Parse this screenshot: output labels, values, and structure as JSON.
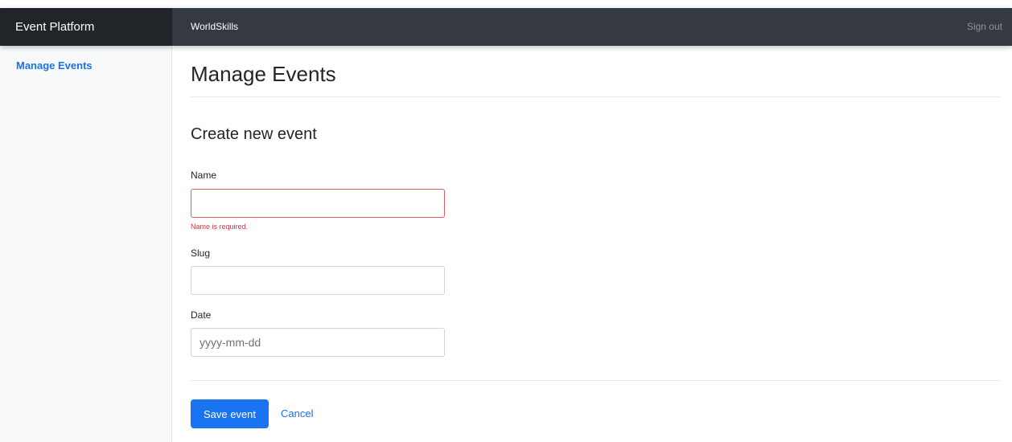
{
  "navbar": {
    "brand": "Event Platform",
    "organization": "WorldSkills",
    "sign_out": "Sign out"
  },
  "sidebar": {
    "items": [
      {
        "label": "Manage Events"
      }
    ]
  },
  "main": {
    "title": "Manage Events",
    "section_title": "Create new event",
    "form": {
      "name": {
        "label": "Name",
        "value": "",
        "placeholder": "",
        "error": "Name is required."
      },
      "slug": {
        "label": "Slug",
        "value": "",
        "placeholder": ""
      },
      "date": {
        "label": "Date",
        "value": "",
        "placeholder": "yyyy-mm-dd"
      }
    },
    "actions": {
      "save_label": "Save event",
      "cancel_label": "Cancel"
    }
  },
  "colors": {
    "navbar_bg": "#343a40",
    "brand_bg": "#212529",
    "accent": "#1a73e8",
    "error": "#dc3545"
  }
}
